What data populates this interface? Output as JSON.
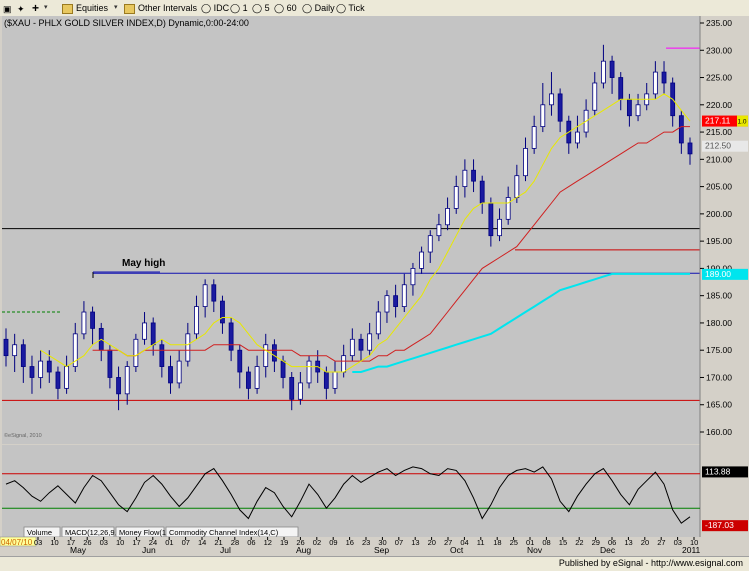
{
  "toolbar": {
    "items": [
      {
        "label": "▣",
        "name": "layout-icon"
      },
      {
        "label": "✦",
        "name": "cross-icon"
      },
      {
        "label": "+",
        "name": "add-icon"
      },
      {
        "label": "▾",
        "name": "chevron-down-icon"
      },
      {
        "label": "Equities",
        "name": "equities-folder"
      },
      {
        "label": "▾",
        "name": "chevron-down-icon"
      },
      {
        "label": "Other Intervals",
        "name": "intervals-folder"
      },
      {
        "label": "IDC",
        "name": "interval-idc"
      },
      {
        "label": "1",
        "name": "interval-1"
      },
      {
        "label": "5",
        "name": "interval-5"
      },
      {
        "label": "60",
        "name": "interval-60"
      },
      {
        "label": "Daily",
        "name": "interval-daily"
      },
      {
        "label": "Tick",
        "name": "interval-tick"
      }
    ]
  },
  "status_bar": {
    "text": "Published by eSignal - http://www.esignal.com"
  },
  "chart_data": {
    "type": "line",
    "title": "($XAU - PHLX GOLD SILVER INDEX,D) Dynamic,0:00-24:00",
    "watermark": "©eSignal, 2010",
    "annotation": "May high",
    "price_axis": {
      "ticks": [
        235,
        230,
        225,
        220,
        215,
        210,
        205,
        200,
        195,
        190,
        185,
        180,
        175,
        170,
        165,
        160
      ]
    },
    "price_labels": [
      {
        "value": 217.11,
        "text": "217.11",
        "extra": "1.0",
        "color": "#ff0000",
        "fg": "#ffffff"
      },
      {
        "value": 212.5,
        "text": "212.50",
        "color": "#e8e8e8",
        "fg": "#555555"
      },
      {
        "value": 189.0,
        "text": "189.00",
        "color": "#00e5ee",
        "fg": "#ffffff"
      }
    ],
    "oscillator": {
      "name": "Commodity Channel Index (14,C)",
      "ticks": [],
      "labels": [
        {
          "text": "113.88",
          "color": "#000000",
          "fg": "#ffffff"
        },
        {
          "text": "-187.03",
          "color": "#ff0000",
          "fg": "#ffffff"
        }
      ]
    },
    "tabs": [
      "Volume",
      "MACD(12,26,9,C)",
      "Money Flow(14)",
      "Commodity Channel Index(14,C)"
    ],
    "date_badge": "04/07/10",
    "x_ticks": [
      "03",
      "10",
      "17",
      "26",
      "03",
      "10",
      "17",
      "24",
      "01",
      "07",
      "14",
      "21",
      "28",
      "06",
      "12",
      "19",
      "26",
      "02",
      "09",
      "16",
      "23",
      "30",
      "07",
      "13",
      "20",
      "27",
      "04",
      "11",
      "18",
      "25",
      "01",
      "08",
      "15",
      "22",
      "29",
      "06",
      "13",
      "20",
      "27",
      "03",
      "10"
    ],
    "month_labels": [
      "May",
      "Jun",
      "Jul",
      "Aug",
      "Sep",
      "Oct",
      "Nov",
      "Dec",
      "2011"
    ],
    "horizontal_lines": [
      {
        "value": 197.3,
        "color": "#000000"
      },
      {
        "value": 193.4,
        "color": "#cc0000"
      },
      {
        "value": 189.1,
        "color": "#1010b0"
      },
      {
        "value": 165.8,
        "color": "#cc0000"
      },
      {
        "value": 230.4,
        "color": "#ff00ff"
      },
      {
        "value": 182.0,
        "color": "#008000"
      }
    ],
    "ohlc": [
      [
        177,
        174,
        179,
        172
      ],
      [
        174,
        176,
        178,
        171
      ],
      [
        176,
        172,
        177,
        169
      ],
      [
        172,
        170,
        174,
        167
      ],
      [
        170,
        173,
        175,
        168
      ],
      [
        173,
        171,
        175,
        169
      ],
      [
        171,
        168,
        172,
        166
      ],
      [
        168,
        172,
        174,
        167
      ],
      [
        172,
        178,
        180,
        171
      ],
      [
        178,
        182,
        184,
        177
      ],
      [
        182,
        179,
        183,
        176
      ],
      [
        179,
        175,
        180,
        173
      ],
      [
        175,
        170,
        176,
        168
      ],
      [
        170,
        167,
        172,
        164
      ],
      [
        167,
        172,
        173,
        165
      ],
      [
        172,
        177,
        178,
        171
      ],
      [
        177,
        180,
        182,
        176
      ],
      [
        180,
        176,
        181,
        174
      ],
      [
        176,
        172,
        177,
        170
      ],
      [
        172,
        169,
        174,
        167
      ],
      [
        169,
        173,
        175,
        168
      ],
      [
        173,
        178,
        180,
        172
      ],
      [
        178,
        183,
        185,
        177
      ],
      [
        183,
        187,
        188,
        181
      ],
      [
        187,
        184,
        188,
        182
      ],
      [
        184,
        180,
        185,
        178
      ],
      [
        180,
        175,
        181,
        173
      ],
      [
        175,
        171,
        176,
        168
      ],
      [
        171,
        168,
        172,
        166
      ],
      [
        168,
        172,
        174,
        167
      ],
      [
        172,
        176,
        178,
        170
      ],
      [
        176,
        173,
        177,
        171
      ],
      [
        173,
        170,
        174,
        168
      ],
      [
        170,
        166,
        171,
        164
      ],
      [
        166,
        169,
        171,
        165
      ],
      [
        169,
        173,
        174,
        168
      ],
      [
        173,
        171,
        175,
        169
      ],
      [
        171,
        168,
        172,
        166
      ],
      [
        168,
        171,
        173,
        167
      ],
      [
        171,
        174,
        176,
        170
      ],
      [
        174,
        177,
        179,
        173
      ],
      [
        177,
        175,
        178,
        173
      ],
      [
        175,
        178,
        180,
        174
      ],
      [
        178,
        182,
        184,
        177
      ],
      [
        182,
        185,
        186,
        180
      ],
      [
        185,
        183,
        187,
        181
      ],
      [
        183,
        187,
        189,
        182
      ],
      [
        187,
        190,
        191,
        185
      ],
      [
        190,
        193,
        194,
        189
      ],
      [
        193,
        196,
        197,
        191
      ],
      [
        196,
        198,
        200,
        195
      ],
      [
        198,
        201,
        203,
        197
      ],
      [
        201,
        205,
        207,
        200
      ],
      [
        205,
        208,
        210,
        203
      ],
      [
        208,
        206,
        210,
        204
      ],
      [
        206,
        202,
        207,
        200
      ],
      [
        202,
        196,
        203,
        194
      ],
      [
        196,
        199,
        201,
        195
      ],
      [
        199,
        203,
        205,
        198
      ],
      [
        203,
        207,
        209,
        202
      ],
      [
        207,
        212,
        214,
        206
      ],
      [
        212,
        216,
        218,
        211
      ],
      [
        216,
        220,
        224,
        215
      ],
      [
        220,
        222,
        226,
        218
      ],
      [
        222,
        217,
        223,
        215
      ],
      [
        217,
        213,
        218,
        211
      ],
      [
        213,
        215,
        218,
        212
      ],
      [
        215,
        219,
        221,
        214
      ],
      [
        219,
        224,
        226,
        218
      ],
      [
        224,
        228,
        231,
        223
      ],
      [
        228,
        225,
        229,
        222
      ],
      [
        225,
        221,
        226,
        219
      ],
      [
        221,
        218,
        222,
        216
      ],
      [
        218,
        220,
        222,
        217
      ],
      [
        220,
        222,
        224,
        219
      ],
      [
        222,
        226,
        228,
        221
      ],
      [
        226,
        224,
        228,
        222
      ],
      [
        224,
        218,
        225,
        216
      ],
      [
        218,
        213,
        219,
        211
      ],
      [
        213,
        211,
        214,
        209
      ]
    ],
    "ma_short": [
      null,
      null,
      null,
      null,
      175,
      174,
      173,
      172,
      173,
      174,
      176,
      177,
      176,
      175,
      174,
      174,
      175,
      176,
      177,
      176,
      176,
      176,
      177,
      178,
      180,
      181,
      181,
      180,
      178,
      176,
      175,
      174,
      173,
      172,
      172,
      172,
      172,
      171,
      171,
      171,
      172,
      173,
      174,
      176,
      177,
      179,
      181,
      183,
      185,
      188,
      190,
      193,
      196,
      199,
      201,
      202,
      202,
      202,
      202,
      203,
      204,
      206,
      209,
      212,
      214,
      215,
      216,
      217,
      218,
      219,
      220,
      221,
      221,
      221,
      221,
      221,
      222,
      221,
      219,
      217
    ],
    "ma_medium": [
      null,
      null,
      null,
      null,
      null,
      null,
      null,
      null,
      null,
      null,
      175,
      175,
      175,
      175,
      174,
      174,
      175,
      175,
      175,
      175,
      175,
      175,
      175,
      175,
      176,
      176,
      176,
      176,
      175,
      175,
      175,
      175,
      175,
      175,
      174,
      174,
      174,
      174,
      173,
      173,
      173,
      173,
      173,
      174,
      174,
      175,
      175,
      176,
      177,
      178,
      180,
      182,
      184,
      186,
      188,
      190,
      191,
      192,
      193,
      194,
      196,
      198,
      200,
      202,
      204,
      205,
      206,
      207,
      208,
      209,
      210,
      211,
      212,
      213,
      213,
      214,
      215,
      215,
      216,
      216
    ],
    "ma_long": [
      null,
      null,
      null,
      null,
      null,
      null,
      null,
      null,
      null,
      null,
      null,
      null,
      null,
      null,
      null,
      null,
      null,
      null,
      null,
      null,
      null,
      null,
      null,
      null,
      null,
      null,
      null,
      null,
      null,
      null,
      null,
      null,
      null,
      null,
      null,
      null,
      null,
      null,
      null,
      null,
      171,
      171,
      171.5,
      172,
      172,
      172.5,
      173,
      173.5,
      174,
      174.5,
      175,
      175.5,
      176,
      176.5,
      177,
      177.5,
      178,
      179,
      180,
      181,
      182,
      183,
      184,
      185,
      186,
      186.5,
      187,
      187.5,
      188,
      188.5,
      189,
      189,
      189,
      189,
      189,
      189,
      189,
      189,
      189,
      189
    ],
    "cci": [
      40,
      60,
      20,
      -30,
      -60,
      -10,
      30,
      -20,
      -70,
      20,
      90,
      60,
      -10,
      -80,
      -120,
      -40,
      50,
      90,
      40,
      -30,
      -90,
      -40,
      30,
      100,
      130,
      60,
      -20,
      -110,
      -160,
      -60,
      20,
      -10,
      -90,
      -150,
      -60,
      40,
      -20,
      -100,
      -40,
      40,
      90,
      50,
      80,
      110,
      130,
      90,
      120,
      140,
      130,
      100,
      90,
      130,
      120,
      60,
      -40,
      -160,
      -80,
      20,
      90,
      120,
      130,
      110,
      140,
      70,
      -60,
      -120,
      -30,
      40,
      100,
      130,
      60,
      -20,
      -80,
      10,
      60,
      110,
      40,
      -110,
      -187,
      -150
    ]
  }
}
